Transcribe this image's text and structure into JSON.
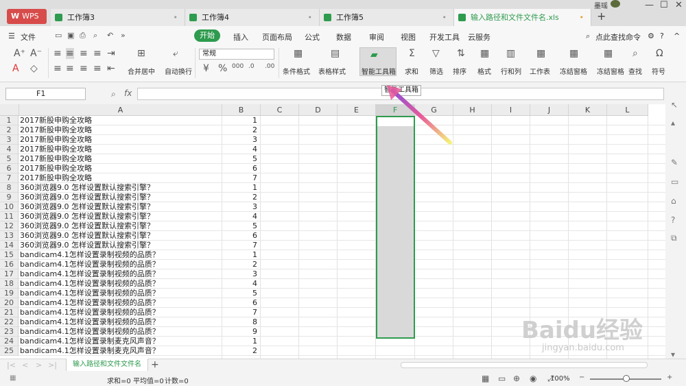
{
  "titlebar": {
    "app_label": "WPS",
    "tabs": [
      {
        "label": "工作簿3",
        "dot": "•"
      },
      {
        "label": "工作簿4",
        "dot": "•"
      },
      {
        "label": "工作簿5",
        "dot": "•"
      },
      {
        "label": "输入路径和文件文件名.xls",
        "dot": "•"
      }
    ],
    "new_tab": "+",
    "user": "墨瑶"
  },
  "menu": {
    "file": "文件",
    "items": [
      "开始",
      "插入",
      "页面布局",
      "公式",
      "数据",
      "审阅",
      "视图",
      "开发工具",
      "云服务"
    ],
    "search": "点此查找命令"
  },
  "ribbon": {
    "merge": "合并居中",
    "wrap": "自动换行",
    "number_format": "常规",
    "conditional": "条件格式",
    "table_style": "表格样式",
    "smart_toolbox": "智能工具箱",
    "sum": "求和",
    "filter": "筛选",
    "sort": "排序",
    "format": "格式",
    "rowcol": "行和列",
    "sheet": "工作表",
    "freeze1": "冻结窗格",
    "freeze2": "冻结窗格",
    "find": "查找",
    "symbol": "符号"
  },
  "formula": {
    "name_box": "F1",
    "fx": "fx"
  },
  "tooltip": "智能工具箱",
  "grid": {
    "columns": [
      "A",
      "B",
      "C",
      "D",
      "E",
      "F",
      "G",
      "H",
      "I",
      "J",
      "K",
      "L"
    ],
    "rows": [
      {
        "n": "1",
        "a": "2017新股申购全攻略",
        "b": "1"
      },
      {
        "n": "2",
        "a": "2017新股申购全攻略",
        "b": "2"
      },
      {
        "n": "3",
        "a": "2017新股申购全攻略",
        "b": "3"
      },
      {
        "n": "4",
        "a": "2017新股申购全攻略",
        "b": "4"
      },
      {
        "n": "5",
        "a": "2017新股申购全攻略",
        "b": "5"
      },
      {
        "n": "6",
        "a": "2017新股申购全攻略",
        "b": "6"
      },
      {
        "n": "7",
        "a": "2017新股申购全攻略",
        "b": "7"
      },
      {
        "n": "8",
        "a": "360浏览器9.0 怎样设置默认搜索引擎？",
        "b": "1"
      },
      {
        "n": "9",
        "a": "360浏览器9.0 怎样设置默认搜索引擎？",
        "b": "2"
      },
      {
        "n": "10",
        "a": "360浏览器9.0 怎样设置默认搜索引擎？",
        "b": "3"
      },
      {
        "n": "11",
        "a": "360浏览器9.0 怎样设置默认搜索引擎？",
        "b": "4"
      },
      {
        "n": "12",
        "a": "360浏览器9.0 怎样设置默认搜索引擎？",
        "b": "5"
      },
      {
        "n": "13",
        "a": "360浏览器9.0 怎样设置默认搜索引擎？",
        "b": "6"
      },
      {
        "n": "14",
        "a": "360浏览器9.0 怎样设置默认搜索引擎？",
        "b": "7"
      },
      {
        "n": "15",
        "a": "bandicam4.1怎样设置录制视频的品质？",
        "b": "1"
      },
      {
        "n": "16",
        "a": "bandicam4.1怎样设置录制视频的品质？",
        "b": "2"
      },
      {
        "n": "17",
        "a": "bandicam4.1怎样设置录制视频的品质？",
        "b": "3"
      },
      {
        "n": "18",
        "a": "bandicam4.1怎样设置录制视频的品质？",
        "b": "4"
      },
      {
        "n": "19",
        "a": "bandicam4.1怎样设置录制视频的品质？",
        "b": "5"
      },
      {
        "n": "20",
        "a": "bandicam4.1怎样设置录制视频的品质？",
        "b": "6"
      },
      {
        "n": "21",
        "a": "bandicam4.1怎样设置录制视频的品质？",
        "b": "7"
      },
      {
        "n": "22",
        "a": "bandicam4.1怎样设置录制视频的品质？",
        "b": "8"
      },
      {
        "n": "23",
        "a": "bandicam4.1怎样设置录制视频的品质？",
        "b": "9"
      },
      {
        "n": "24",
        "a": "bandicam4.1怎样设置录制麦克风声音？",
        "b": "1"
      },
      {
        "n": "25",
        "a": "bandicam4.1怎样设置录制麦克风声音？",
        "b": "2"
      }
    ]
  },
  "sheet_tab": "输入路径和文件文件名",
  "status": {
    "sum": "求和=0",
    "avg": "平均值=0",
    "count": "计数=0",
    "zoom": "100%"
  },
  "watermark": {
    "main": "Baidu经验",
    "sub": "jingyan.baidu.com"
  },
  "colors": {
    "accent": "#2e9b4e",
    "wps_red": "#d84b4b"
  }
}
